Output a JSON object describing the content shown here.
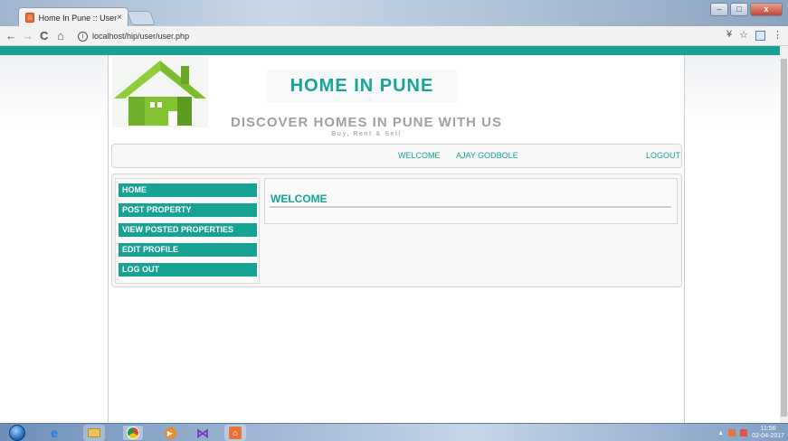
{
  "browser": {
    "tab_title": "Home In Pune :: User",
    "tab_close": "×",
    "url": "localhost/hip/user/user.php",
    "nav_back": "←",
    "nav_forward": "→",
    "nav_reload": "C",
    "nav_home": "⌂",
    "info": "i",
    "ext": "¥",
    "star": "☆",
    "menu": "⋮",
    "win_min": "–",
    "win_max": "□",
    "win_close": "x"
  },
  "header": {
    "site_title": "HOME IN PUNE",
    "tagline": "DISCOVER HOMES IN PUNE WITH US",
    "subline": "Buy, Rent & Sell"
  },
  "userbar": {
    "welcome": "WELCOME",
    "user_name": "AJAY GODBOLE",
    "logout": "LOGOUT"
  },
  "menu": {
    "items": [
      {
        "label": "HOME"
      },
      {
        "label": "POST PROPERTY"
      },
      {
        "label": "VIEW POSTED PROPERTIES"
      },
      {
        "label": "EDIT PROFILE"
      },
      {
        "label": "LOG OUT"
      }
    ]
  },
  "main": {
    "heading": "WELCOME"
  },
  "taskbar": {
    "clock_time": "11:56",
    "clock_date": "02-04-2017"
  },
  "colors": {
    "accent": "#16a394",
    "text_accent": "#15a495",
    "tagline_gray": "#a0a0a0"
  },
  "icons": [
    "favicon-icon",
    "back-icon",
    "forward-icon",
    "reload-icon",
    "home-icon",
    "info-icon",
    "star-icon",
    "menu-icon",
    "house-logo-icon",
    "start-orb-icon",
    "ie-icon",
    "folder-icon",
    "chrome-icon",
    "media-player-icon",
    "vs-icon",
    "xampp-icon"
  ]
}
